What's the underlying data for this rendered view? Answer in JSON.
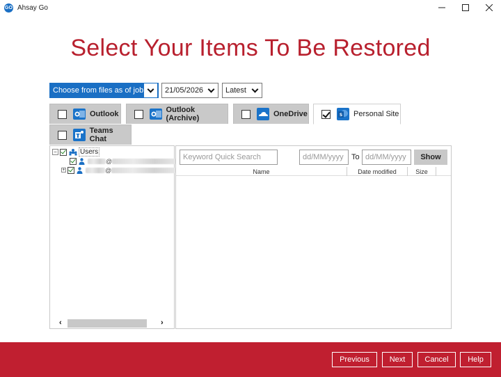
{
  "window": {
    "title": "Ahsay Go",
    "logo_text": "GO"
  },
  "heading": "Select Your Items To Be Restored",
  "selectors": {
    "mode": "Choose from files as of job",
    "date": "21/05/2026",
    "version": "Latest"
  },
  "tabs": [
    {
      "label": "Outlook",
      "checked": false,
      "icon": "outlook-icon"
    },
    {
      "label": "Outlook (Archive)",
      "checked": false,
      "icon": "outlook-archive-icon"
    },
    {
      "label": "OneDrive",
      "checked": false,
      "icon": "onedrive-icon"
    },
    {
      "label": "Personal Site",
      "checked": true,
      "icon": "sharepoint-icon"
    },
    {
      "label": "Teams Chat",
      "checked": false,
      "icon": "teams-icon"
    }
  ],
  "tree": {
    "root_label": "Users",
    "user1_domain_fragment": "@",
    "user2_domain_fragment": "@"
  },
  "filter": {
    "search_placeholder": "Keyword Quick Search",
    "from_placeholder": "dd/MM/yyyy",
    "to_label": "To",
    "to_placeholder": "dd/MM/yyyy",
    "show_label": "Show"
  },
  "table": {
    "columns": [
      "Name",
      "Date modified",
      "Size"
    ]
  },
  "footer": {
    "previous": "Previous",
    "next": "Next",
    "cancel": "Cancel",
    "help": "Help"
  },
  "colors": {
    "accent": "#b8202e",
    "footer": "#c01f30",
    "primary": "#1a6fc4"
  }
}
